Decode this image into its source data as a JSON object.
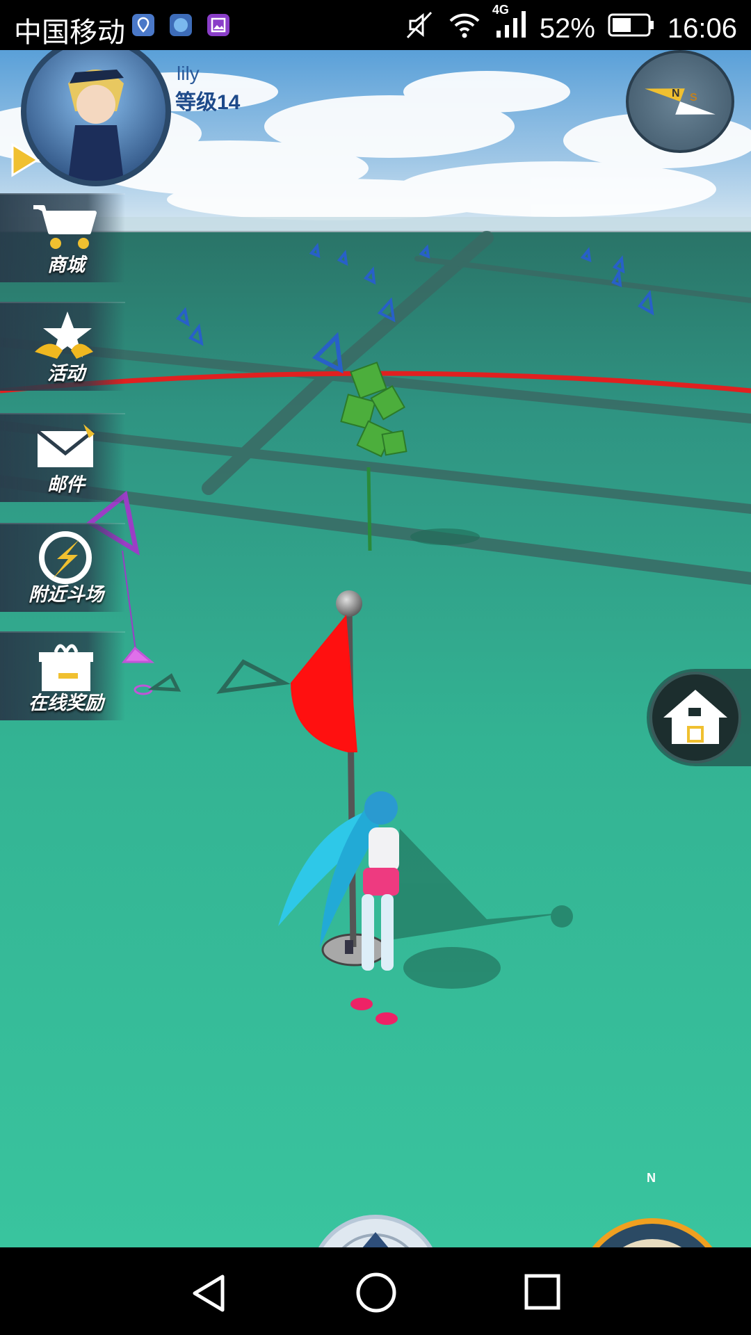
{
  "status_bar": {
    "carrier": "中国移动",
    "network": "4G",
    "battery": "52%",
    "time": "16:06",
    "icons": [
      "location-app-icon",
      "heart-app-icon",
      "gallery-app-icon",
      "mute-icon",
      "wifi-icon",
      "signal-icon",
      "battery-icon"
    ]
  },
  "player": {
    "name": "lily",
    "level": "等级14"
  },
  "compass_letters": {
    "n": "N",
    "s": "S"
  },
  "side_menu": [
    {
      "label": "商城",
      "icon": "cart-icon"
    },
    {
      "label": "活动",
      "icon": "star-icon"
    },
    {
      "label": "邮件",
      "icon": "mail-icon"
    },
    {
      "label": "附近斗场",
      "icon": "lightning-arena-icon"
    },
    {
      "label": "在线奖励",
      "icon": "gift-icon"
    }
  ],
  "minimap": {
    "north_label": "N"
  },
  "colors": {
    "ground": "#33b896",
    "boundary_line": "#e02020",
    "flag": "#ff1010",
    "menu_bg": "#2b3d4b"
  }
}
